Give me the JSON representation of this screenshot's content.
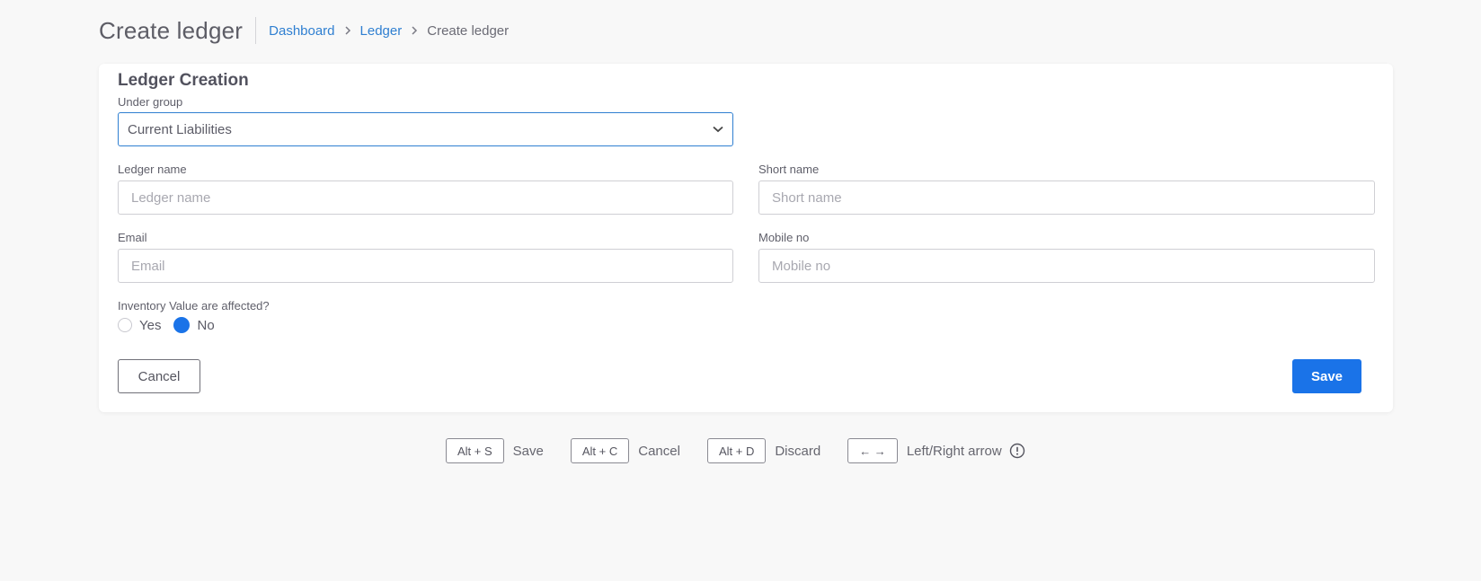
{
  "header": {
    "title": "Create ledger",
    "breadcrumb": [
      "Dashboard",
      "Ledger",
      "Create ledger"
    ]
  },
  "form": {
    "title": "Ledger Creation",
    "under_group": {
      "label": "Under group",
      "value": "Current Liabilities"
    },
    "ledger_name": {
      "label": "Ledger name",
      "placeholder": "Ledger name"
    },
    "short_name": {
      "label": "Short name",
      "placeholder": "Short name"
    },
    "email": {
      "label": "Email",
      "placeholder": "Email"
    },
    "mobile": {
      "label": "Mobile no",
      "placeholder": "Mobile no"
    },
    "inventory": {
      "label": "Inventory Value are affected?",
      "options": [
        "Yes",
        "No"
      ],
      "selected": "No"
    },
    "cancel_label": "Cancel",
    "save_label": "Save"
  },
  "shortcuts": [
    {
      "key": "Alt + S",
      "label": "Save"
    },
    {
      "key": "Alt + C",
      "label": "Cancel"
    },
    {
      "key": "Alt + D",
      "label": "Discard"
    },
    {
      "key": "← →",
      "label": "Left/Right arrow"
    }
  ],
  "colors": {
    "accent": "#1a73e8",
    "link": "#2f7fd1",
    "background": "#f8f8f8"
  },
  "icons": [
    "chevron-right-icon",
    "chevron-down-icon",
    "info-icon"
  ]
}
